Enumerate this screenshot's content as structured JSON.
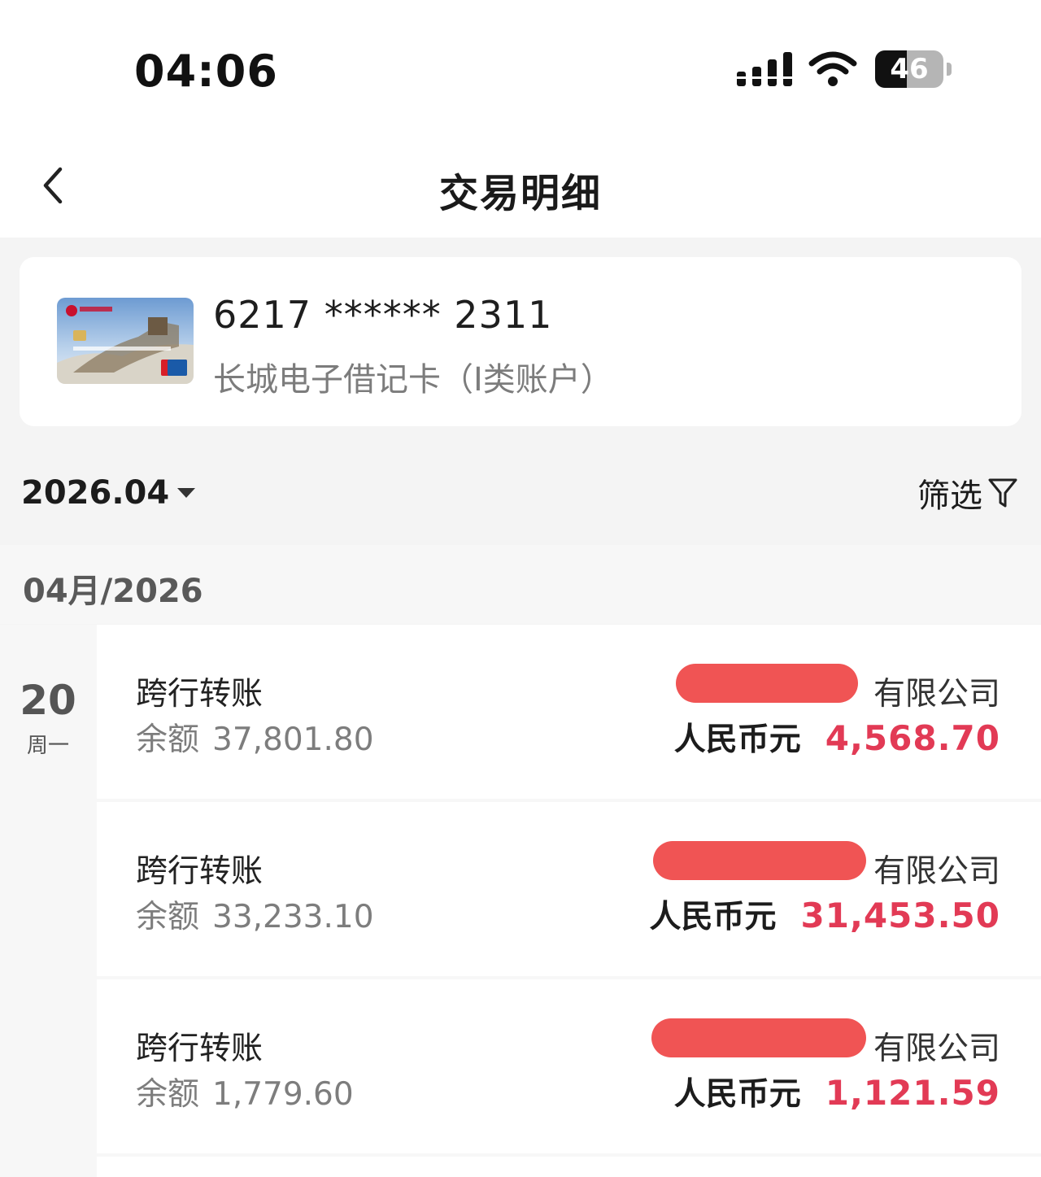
{
  "status_bar": {
    "time": "04:06",
    "battery_level": "46",
    "battery_fraction": 0.46,
    "icons": [
      "signal-icon",
      "wifi-icon",
      "battery-icon"
    ]
  },
  "header": {
    "title": "交易明细",
    "back_icon": "chevron-left-icon"
  },
  "account": {
    "card_number": "6217 ****** 2311",
    "card_type": "长城电子借记卡（I类账户）",
    "card_image_icon": "bank-card-image"
  },
  "filter_bar": {
    "selected_month": "2026.04",
    "filter_label": "筛选",
    "filter_icon": "funnel-icon"
  },
  "month_group": {
    "label": "04月/2026",
    "day": "20",
    "weekday": "周一"
  },
  "transactions": [
    {
      "type": "跨行转账",
      "balance_label": "余额",
      "balance": "37,801.80",
      "counterparty": "有限公司",
      "currency": "人民币元",
      "amount": "4,568.70"
    },
    {
      "type": "跨行转账",
      "balance_label": "余额",
      "balance": "33,233.10",
      "counterparty": "有限公司",
      "currency": "人民币元",
      "amount": "31,453.50"
    },
    {
      "type": "跨行转账",
      "balance_label": "余额",
      "balance": "1,779.60",
      "counterparty": "有限公司",
      "currency": "人民币元",
      "amount": "1,121.59"
    }
  ],
  "colors": {
    "amount_red": "#e23a55",
    "redaction_red": "#f05454",
    "page_bg": "#f4f4f4"
  }
}
